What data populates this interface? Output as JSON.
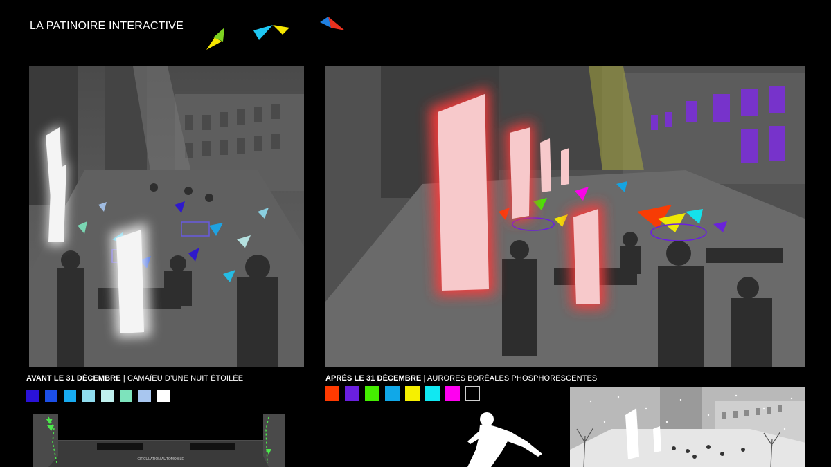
{
  "header": {
    "title": "LA PATINOIRE INTERACTIVE"
  },
  "logo": {
    "colors": [
      "#f6e600",
      "#7ed321",
      "#1fc7f3",
      "#f6e600",
      "#1f7fe0",
      "#e8311f"
    ]
  },
  "left": {
    "caption_bold": "AVANT LE 31 DÉCEMBRE",
    "caption_rest": " | CAMAÏEU D’UNE NUIT ÉTOILÉE",
    "swatches": [
      "#2a12d8",
      "#1c4fe8",
      "#18aaf0",
      "#8fdcee",
      "#bff0ee",
      "#7de3bc",
      "#a8c6ef",
      "#ffffff"
    ]
  },
  "right": {
    "caption_bold": "APRÈS LE 31 DÉCEMBRE",
    "caption_rest": " | AURORES BORÉALES PHOSPHORESCENTES",
    "swatches": [
      "#ff3a00",
      "#6a1fe0",
      "#44ee00",
      "#10a8e8",
      "#f6f000",
      "#10e8f2",
      "#ff00f0",
      "#000000"
    ]
  },
  "plan": {
    "road_label": "CIRCULATION AUTOMOBILE"
  }
}
